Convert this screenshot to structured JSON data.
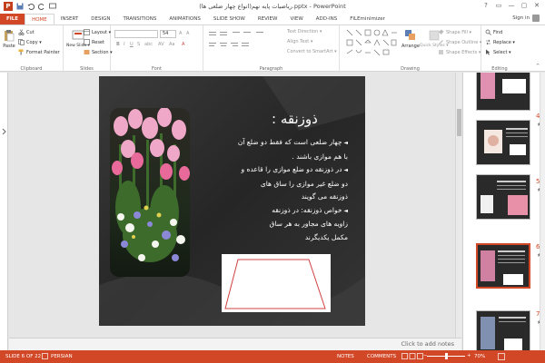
{
  "window": {
    "title": "ریاضیات پایه نهم(انواع چهار ضلعی ها).pptx - PowerPoint",
    "controls": [
      "?",
      "▭",
      "—",
      "▢",
      "✕"
    ]
  },
  "tabs": [
    {
      "label": "FILE"
    },
    {
      "label": "HOME"
    },
    {
      "label": "INSERT"
    },
    {
      "label": "DESIGN"
    },
    {
      "label": "TRANSITIONS"
    },
    {
      "label": "ANIMATIONS"
    },
    {
      "label": "SLIDE SHOW"
    },
    {
      "label": "REVIEW"
    },
    {
      "label": "VIEW"
    },
    {
      "label": "ADD-INS"
    },
    {
      "label": "FILEminimizer"
    }
  ],
  "signin": "Sign in",
  "ribbon": {
    "clipboard": {
      "label": "Clipboard",
      "paste": "Paste",
      "cut": "Cut",
      "copy": "Copy ▾",
      "format_painter": "Format Painter"
    },
    "slides": {
      "label": "Slides",
      "new_slide": "New Slide ▾",
      "layout": "Layout ▾",
      "reset": "Reset",
      "section": "Section ▾"
    },
    "font": {
      "label": "Font",
      "size": "54"
    },
    "paragraph": {
      "label": "Paragraph",
      "text_direction": "Text Direction ▾",
      "align_text": "Align Text ▾",
      "convert_smartart": "Convert to SmartArt ▾"
    },
    "drawing": {
      "label": "Drawing",
      "arrange": "Arrange",
      "quick_styles": "Quick Styles ▾",
      "shape_fill": "Shape Fill ▾",
      "shape_outline": "Shape Outline ▾",
      "shape_effects": "Shape Effects ▾"
    },
    "editing": {
      "label": "Editing",
      "find": "Find",
      "replace": "Replace ▾",
      "select": "Select ▾"
    }
  },
  "slide": {
    "title": "ذوزنقه :",
    "body": [
      {
        "text": "چهار ضلعی است که فقط  دو ضلع آن",
        "bullet": true
      },
      {
        "text": "با هم موازی باشند .",
        "bullet": false
      },
      {
        "text": "در ذوزنقه دو ضلع موازی را قاعده و",
        "bullet": true
      },
      {
        "text": "دو ضلع غیر موازی را ساق های",
        "bullet": false
      },
      {
        "text": "ذوزنقه می گویند",
        "bullet": false
      },
      {
        "text": "خواص ذوزنقه: در ذوزنقه",
        "bullet": true
      },
      {
        "text": "زاویه های مجاور به هر ساق",
        "bullet": false
      },
      {
        "text": "مکمل یکدیگرند",
        "bullet": false
      }
    ]
  },
  "notes_placeholder": "Click to add notes",
  "thumbnails": [
    {
      "number": "4",
      "selected": false
    },
    {
      "number": "5",
      "selected": false
    },
    {
      "number": "6",
      "selected": true
    },
    {
      "number": "7",
      "selected": false
    }
  ],
  "status": {
    "slide_pos": "SLIDE 6 OF 22",
    "language": "PERSIAN",
    "notes": "NOTES",
    "comments": "COMMENTS",
    "zoom": "70%",
    "zoom_fraction": 0.7
  },
  "colors": {
    "accent": "#d24726",
    "slide_bg": "#2a2a2a"
  }
}
